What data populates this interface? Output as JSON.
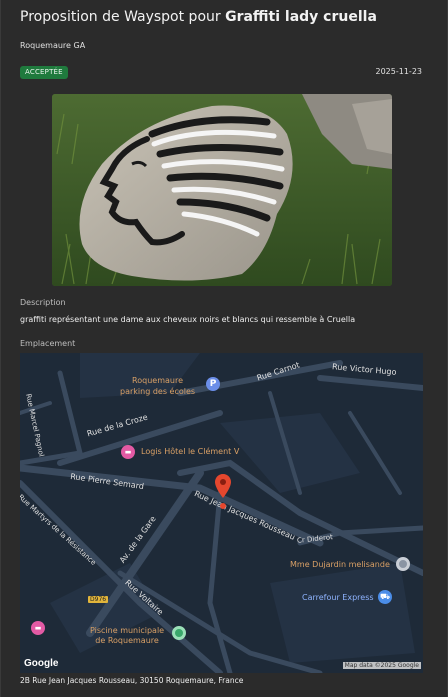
{
  "header": {
    "title_prefix": "Proposition de Wayspot pour ",
    "title_name": "Graffiti lady cruella",
    "author": "Roquemaure GA",
    "status": "ACCEPTÉE",
    "date": "2025-11-23"
  },
  "photo": {
    "subject": "stone-with-face-graffiti"
  },
  "description": {
    "label": "Description",
    "text": "graffiti représentant une dame aux cheveux noirs et blancs qui ressemble à Cruella"
  },
  "location": {
    "label": "Emplacement",
    "address": "2B Rue Jean Jacques Rousseau, 30150 Roquemaure, France"
  },
  "map": {
    "streets": [
      "Rue Carnot",
      "Rue Victor Hugo",
      "Rue Marcel Pagnol",
      "Rue de la Croze",
      "Rue Pierre Semard",
      "Rue Jean Jacques Rousseau",
      "Rue Martyrs de la Résistance",
      "Av. de la Gare",
      "Rue Voltaire",
      "Cr Diderot"
    ],
    "road_badge": "D976",
    "pois": [
      {
        "name_line1": "Roquemaure",
        "name_line2": "parking des écoles",
        "icon": "parking-icon"
      },
      {
        "name_line1": "Logis Hôtel le Clément V",
        "icon": "hotel-icon"
      },
      {
        "name_line1": "Mme Dujardin melisande",
        "icon": "place-icon"
      },
      {
        "name_line1": "Carrefour Express",
        "icon": "shopping-icon"
      },
      {
        "name_line1": "Piscine municipale",
        "name_line2": "de Roquemaure",
        "icon": "pool-icon"
      }
    ],
    "google_logo": "Google",
    "attribution": "Map data ©2025 Google",
    "colors": {
      "background": "#1e2a38",
      "road": "#3a4a5e",
      "street_label": "#e0e0e0",
      "poi_label": "#d9a066",
      "marker": "#e5472e"
    }
  }
}
